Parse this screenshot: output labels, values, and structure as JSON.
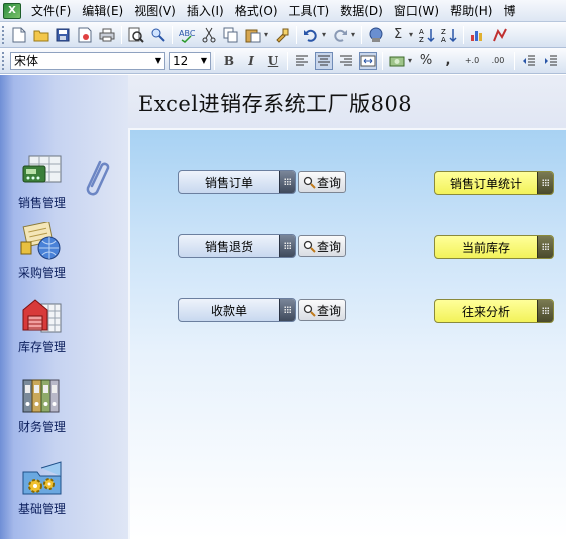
{
  "menubar": {
    "items": [
      {
        "label": "文件(F)",
        "name": "menu-file"
      },
      {
        "label": "编辑(E)",
        "name": "menu-edit"
      },
      {
        "label": "视图(V)",
        "name": "menu-view"
      },
      {
        "label": "插入(I)",
        "name": "menu-insert"
      },
      {
        "label": "格式(O)",
        "name": "menu-format"
      },
      {
        "label": "工具(T)",
        "name": "menu-tools"
      },
      {
        "label": "数据(D)",
        "name": "menu-data"
      },
      {
        "label": "窗口(W)",
        "name": "menu-window"
      },
      {
        "label": "帮助(H)",
        "name": "menu-help"
      },
      {
        "label": "博",
        "name": "menu-overflow"
      }
    ]
  },
  "toolbar": {
    "font_name": "宋体",
    "font_size": "12",
    "bold": "B",
    "italic": "I",
    "underline": "U",
    "sigma": "Σ",
    "percent": "%",
    "comma": ",",
    "inc_decimal": "+.0",
    "dec_decimal": ".00"
  },
  "app": {
    "title": "Excel进销存系统工厂版808"
  },
  "nav": [
    {
      "label": "销售管理",
      "icon": "sales-register-icon"
    },
    {
      "label": "采购管理",
      "icon": "purchase-globe-icon"
    },
    {
      "label": "库存管理",
      "icon": "warehouse-icon"
    },
    {
      "label": "财务管理",
      "icon": "binders-icon"
    },
    {
      "label": "基础管理",
      "icon": "gears-folder-icon"
    }
  ],
  "main": {
    "left_buttons": [
      {
        "label": "销售订单",
        "query": "查询"
      },
      {
        "label": "销售退货",
        "query": "查询"
      },
      {
        "label": "收款单",
        "query": "查询"
      }
    ],
    "right_buttons": [
      {
        "label": "销售订单统计"
      },
      {
        "label": "当前库存"
      },
      {
        "label": "往来分析"
      }
    ]
  },
  "colors": {
    "blue_button": "#c8d8ef",
    "yellow_button": "#f2f25a",
    "nav_label": "#0b1e5c"
  }
}
